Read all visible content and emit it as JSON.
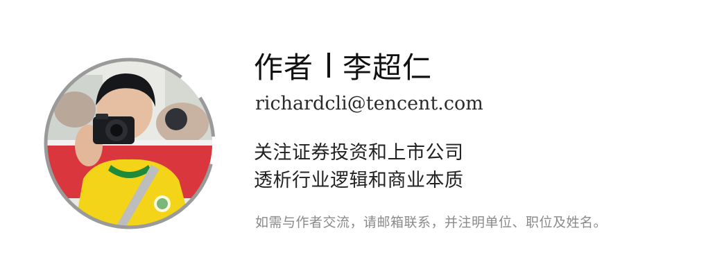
{
  "author": {
    "label": "作者",
    "name": "李超仁"
  },
  "email": "richardcli@tencent.com",
  "taglines": [
    "关注证券投资和上市公司",
    "透析行业逻辑和商业本质"
  ],
  "contact_note": "如需与作者交流，请邮箱联系，并注明单位、职位及姓名。",
  "colors": {
    "text_primary": "#111111",
    "text_secondary": "#8a8a8a",
    "ring": "#9a9a9a",
    "jersey_yellow": "#f3d418",
    "jersey_green": "#1f8a3a",
    "banner_red": "#d9363e"
  },
  "icons": {
    "avatar": "author-photo"
  }
}
